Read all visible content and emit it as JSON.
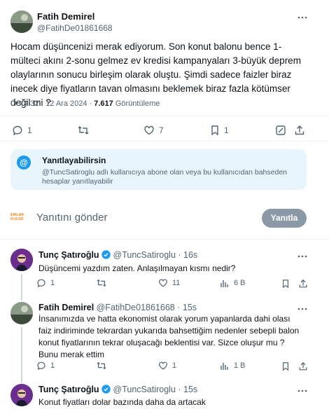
{
  "main_tweet": {
    "name": "Fatih Demirel",
    "handle": "@FatihDe01861668",
    "text": "Hocam düşüncenizi merak ediyorum. Son konut balonu bence 1-mülteci akını 2-sonu gelmez ev kredisi kampanyaları 3-büyük deprem olaylarının sonucu birleşim olarak oluştu. Şimdi sadece faizler biraz inecek diye fiyatların tavan olmasını beklemek biraz fazla kötümser değil mi ?",
    "time": "ÖS 4:32 · 12 Ara 2024 · ",
    "views_count": "7.617",
    "views_label": " Görüntüleme",
    "replies": "1",
    "retweets": "",
    "likes": "7",
    "bookmarks": "1"
  },
  "reply_notice": {
    "title": "Yanıtlayabilirsin",
    "text": "@TuncSatiroglu adlı kullanıcıya abone olan veya bu kullanıcıdan bahseden hesaplar yanıtlayabilir"
  },
  "composer": {
    "avatar_text": "EMLAK KULİSİ",
    "placeholder": "Yanıtını gönder",
    "button_label": "Yanıtla"
  },
  "replies": [
    {
      "name": "Tunç Şatıroğlu",
      "handle": "@TuncSatiroglu",
      "time": "· 16s",
      "text": "Düşüncemi yazdım zaten. Anlaşılmayan kısmı nedir?",
      "replies": "1",
      "retweets": "",
      "likes": "11",
      "views": "6 B"
    },
    {
      "name": "Fatih Demirel",
      "handle": "@FatihDe01861668",
      "time": "· 15s",
      "text": "İnsanımızda ve hatta ekonomist olarak yorum yapanlarda dahi olası faiz indiriminde tekrardan yukarıda bahsettiğim nedenler sebepli balon konut fiyatlarının tekrar oluşacağı beklentisi var. Sizce oluşur mu ? Bunu merak ettim",
      "replies": "1",
      "retweets": "",
      "likes": "1",
      "views": "1 B"
    },
    {
      "name": "Tunç Şatıroğlu",
      "handle": "@TuncSatiroglu",
      "time": "· 15s",
      "text": "Konut fiyatları dolar bazında daha da artacak"
    }
  ],
  "colors": {
    "accent": "#1d9bf0",
    "text": "#0f1419",
    "muted": "#536471",
    "notice_bg": "#e8f5fd",
    "button_bg": "#8b98a5",
    "verified": "#1d9bf0"
  }
}
